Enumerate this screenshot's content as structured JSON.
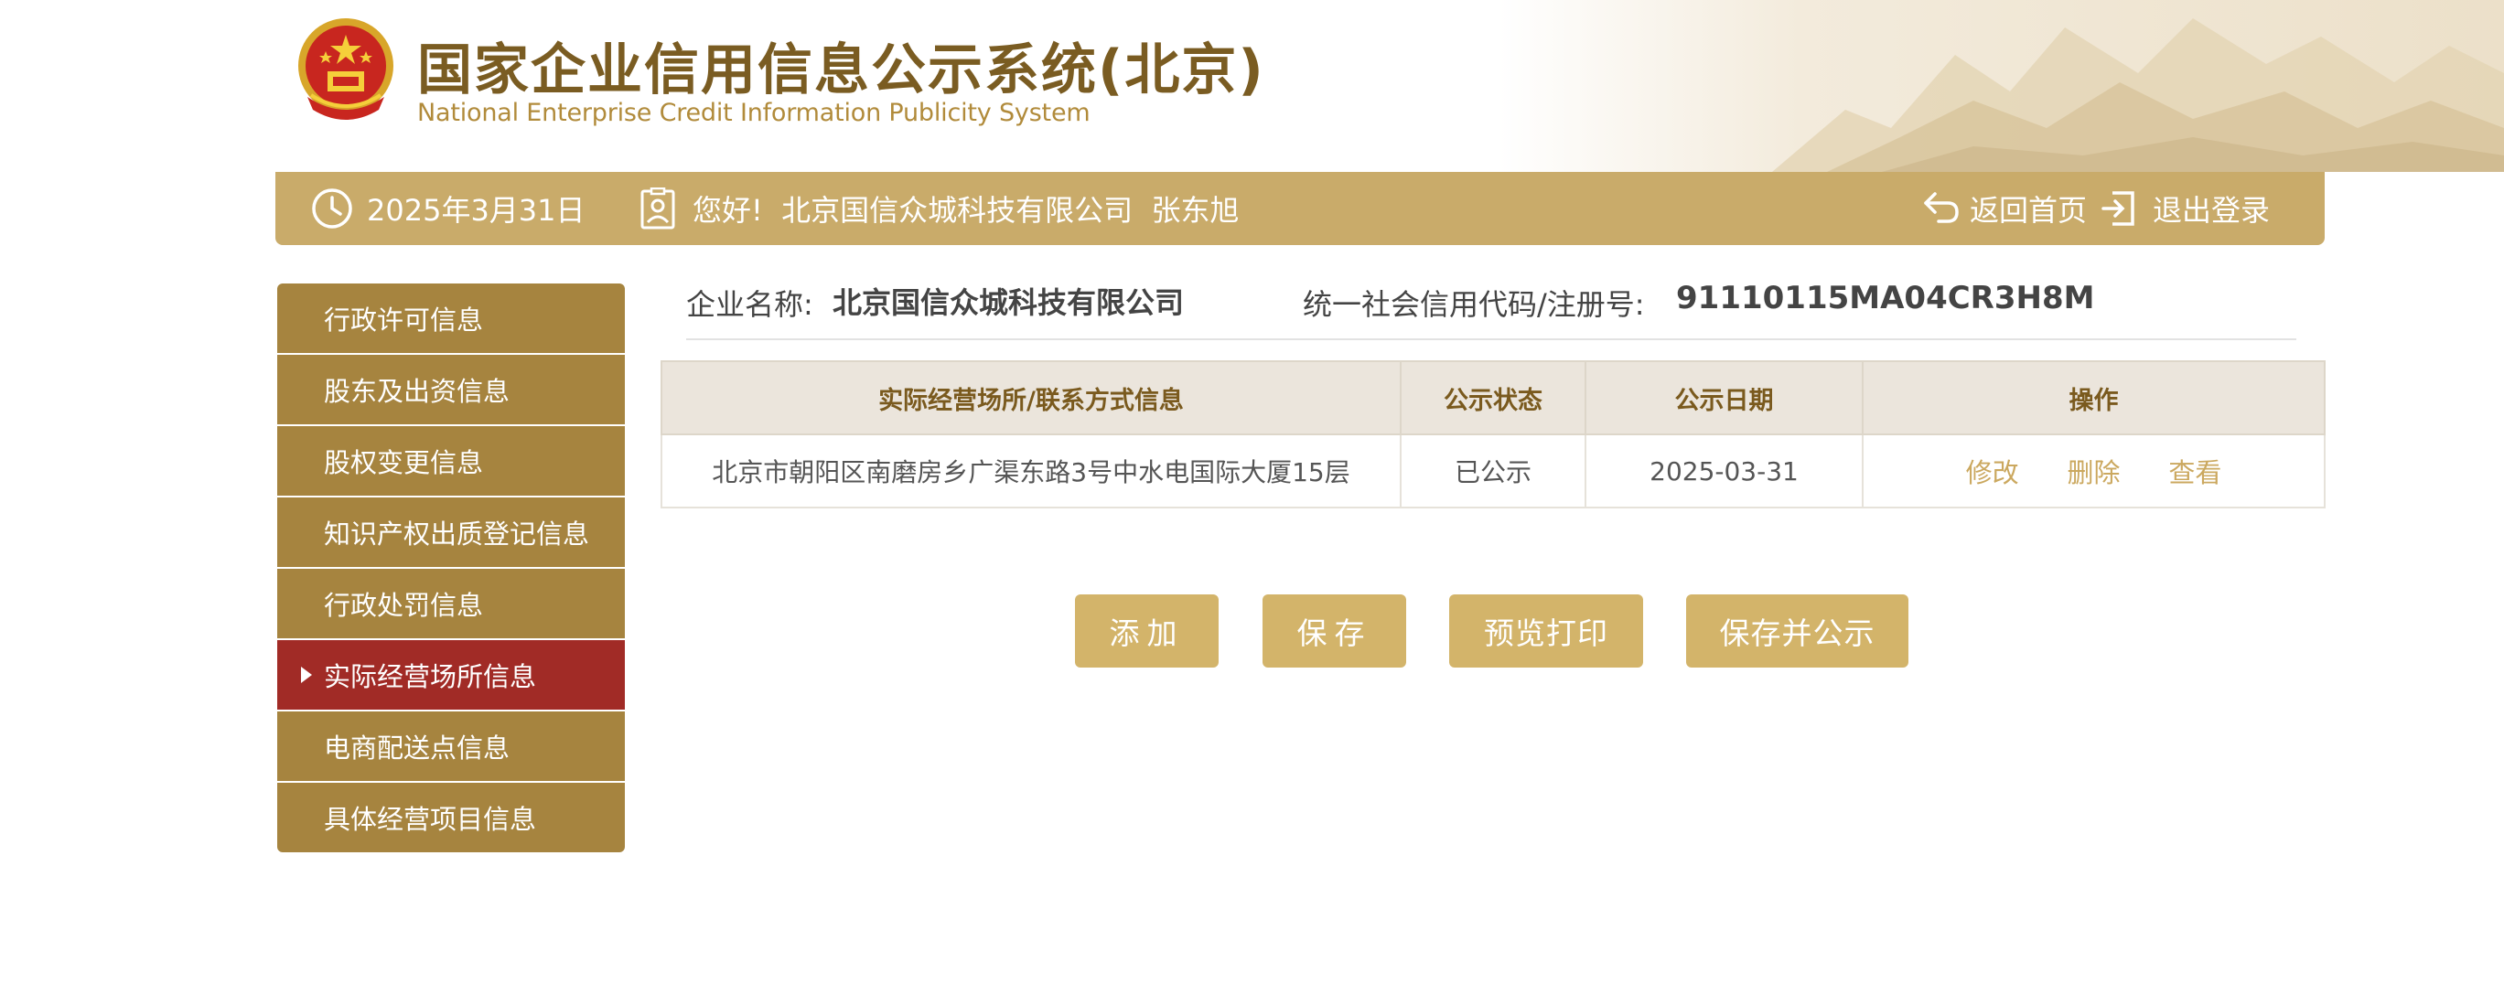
{
  "header": {
    "title_cn": "国家企业信用信息公示系统(北京)",
    "title_en": "National Enterprise Credit Information Publicity System"
  },
  "topbar": {
    "date": "2025年3月31日",
    "greeting": "您好!  北京国信众城科技有限公司  张东旭",
    "home_label": "返回首页",
    "logout_label": "退出登录"
  },
  "sidebar": {
    "items": [
      {
        "label": "行政许可信息",
        "active": false
      },
      {
        "label": "股东及出资信息",
        "active": false
      },
      {
        "label": "股权变更信息",
        "active": false
      },
      {
        "label": "知识产权出质登记信息",
        "active": false
      },
      {
        "label": "行政处罚信息",
        "active": false
      },
      {
        "label": "实际经营场所信息",
        "active": true
      },
      {
        "label": "电商配送点信息",
        "active": false
      },
      {
        "label": "具体经营项目信息",
        "active": false
      }
    ]
  },
  "company": {
    "name_label": "企业名称:",
    "name_value": "北京国信众城科技有限公司",
    "code_label": "统一社会信用代码/注册号:",
    "code_value": "91110115MA04CR3H8M"
  },
  "table": {
    "headers": [
      "实际经营场所/联系方式信息",
      "公示状态",
      "公示日期",
      "操作"
    ],
    "rows": [
      {
        "address": "北京市朝阳区南磨房乡广渠东路3号中水电国际大厦15层",
        "status": "已公示",
        "date": "2025-03-31",
        "actions": [
          "修改",
          "删除",
          "查看"
        ]
      }
    ]
  },
  "buttons": {
    "add": "添加",
    "save": "保存",
    "preview_print": "预览打印",
    "save_publish": "保存并公示"
  },
  "colors": {
    "gold_bar": "#c9ab6a",
    "sidebar": "#a6843f",
    "sidebar_active": "#a12b26",
    "button": "#d3b46a",
    "link": "#cba85f"
  },
  "icons": [
    "emblem-icon",
    "clock-icon",
    "user-badge-icon",
    "return-icon",
    "logout-icon"
  ]
}
